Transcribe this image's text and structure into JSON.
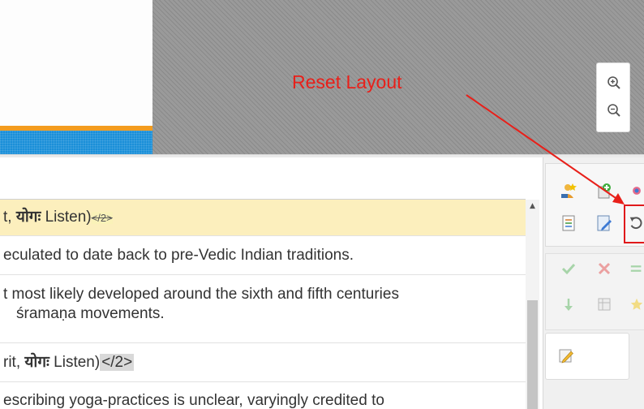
{
  "annotation": {
    "label": "Reset Layout",
    "color": "#e8201a"
  },
  "canvas": {
    "zoom_in_icon": "zoom-in-icon",
    "zoom_out_icon": "zoom-out-icon"
  },
  "list": {
    "rows": [
      {
        "pre": "t, ",
        "bold": "योगः",
        "post": " Listen)",
        "tag": "</2>",
        "style": "highlight"
      },
      {
        "text": "eculated to date back to pre-Vedic Indian traditions."
      },
      {
        "text1": "t most likely developed around the sixth and fifth centuries",
        "text2": "śramaṇa movements."
      },
      {
        "pre": "rit, ",
        "bold": "योगः",
        "post": " Listen)",
        "tag": "</2>"
      },
      {
        "text": "escribing yoga-practices is unclear, varyingly credited to"
      }
    ]
  },
  "toolbar": {
    "row1": [
      "add-user-icon",
      "add-green-icon",
      "view-icon"
    ],
    "row2": [
      "document-list-icon",
      "edit-document-icon",
      "reset-layout-icon"
    ],
    "row3": [
      "accept-icon",
      "reject-icon",
      "merge-icon"
    ],
    "row4": [
      "split-down-icon",
      "table-icon",
      "star-icon"
    ],
    "row5": [
      "edit-pencil-icon"
    ]
  },
  "colors": {
    "accent_orange": "#f39c1f",
    "accent_blue": "#1a8fd8",
    "annotation_red": "#e0191b",
    "highlight_row": "#fcefbd"
  }
}
